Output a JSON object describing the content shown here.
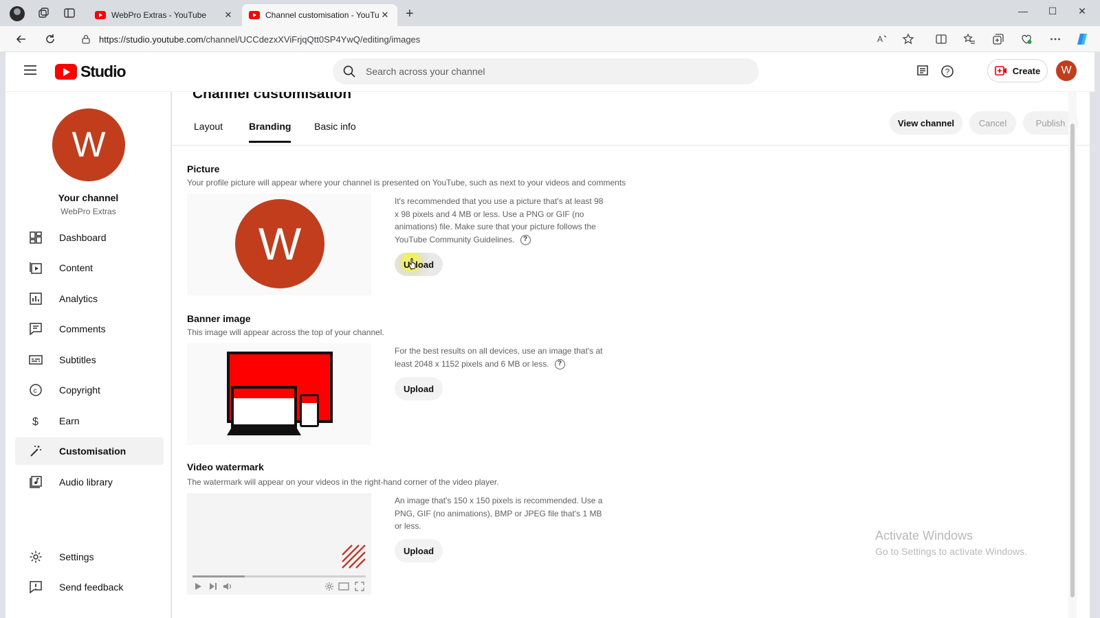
{
  "browser": {
    "tabs": [
      {
        "label": "WebPro Extras - YouTube",
        "active": false
      },
      {
        "label": "Channel customisation - YouTube",
        "active": true
      }
    ],
    "url_host": "https://studio.youtube.com",
    "url_path": "/channel/UCCdezxXViFrjqQtt0SP4YwQ/editing/images",
    "icons": [
      "profile-icon",
      "workspaces-icon",
      "tab-actions-icon",
      "back-icon",
      "refresh-icon",
      "lock-icon",
      "read-aloud-icon",
      "favorite-icon",
      "split-screen-icon",
      "favorites-icon",
      "collections-icon",
      "browser-essentials-icon",
      "more-icon",
      "copilot-icon"
    ]
  },
  "header": {
    "logo_text": "Studio",
    "search_placeholder": "Search across your channel",
    "create_label": "Create",
    "avatar_letter": "W"
  },
  "sidebar": {
    "avatar_letter": "W",
    "channel_title": "Your channel",
    "channel_name": "WebPro Extras",
    "items": [
      {
        "label": "Dashboard",
        "icon": "dashboard-icon"
      },
      {
        "label": "Content",
        "icon": "content-icon"
      },
      {
        "label": "Analytics",
        "icon": "analytics-icon"
      },
      {
        "label": "Comments",
        "icon": "comments-icon"
      },
      {
        "label": "Subtitles",
        "icon": "subtitles-icon"
      },
      {
        "label": "Copyright",
        "icon": "copyright-icon"
      },
      {
        "label": "Earn",
        "icon": "earn-icon"
      },
      {
        "label": "Customisation",
        "icon": "customisation-icon",
        "selected": true
      },
      {
        "label": "Audio library",
        "icon": "audio-library-icon"
      }
    ],
    "bottom_items": [
      {
        "label": "Settings",
        "icon": "gear-icon"
      },
      {
        "label": "Send feedback",
        "icon": "feedback-icon"
      }
    ]
  },
  "main": {
    "title": "Channel customisation",
    "tabs": [
      {
        "label": "Layout"
      },
      {
        "label": "Branding",
        "selected": true
      },
      {
        "label": "Basic info"
      }
    ],
    "actions": {
      "view_channel": "View channel",
      "cancel": "Cancel",
      "publish": "Publish"
    },
    "picture": {
      "title": "Picture",
      "description": "Your profile picture will appear where your channel is presented on YouTube, such as next to your videos and comments",
      "avatar_letter": "W",
      "info": "It's recommended that you use a picture that's at least 98 x 98 pixels and 4 MB or less. Use a PNG or GIF (no animations) file. Make sure that your picture follows the YouTube Community Guidelines.",
      "upload_label": "Upload"
    },
    "banner": {
      "title": "Banner image",
      "description": "This image will appear across the top of your channel.",
      "info": "For the best results on all devices, use an image that's at least 2048 x 1152 pixels and 6 MB or less.",
      "upload_label": "Upload"
    },
    "watermark": {
      "title": "Video watermark",
      "description": "The watermark will appear on your videos in the right-hand corner of the video player.",
      "info": "An image that's 150 x 150 pixels is recommended. Use a PNG, GIF (no animations), BMP or JPEG file that's 1 MB or less.",
      "upload_label": "Upload"
    },
    "help_mark": "?"
  },
  "os_watermark": {
    "line1": "Activate Windows",
    "line2": "Go to Settings to activate Windows."
  },
  "colors": {
    "brand_red": "#ff0000",
    "avatar": "#c13d1b",
    "text": "#0f0f0f",
    "muted": "#606060"
  }
}
